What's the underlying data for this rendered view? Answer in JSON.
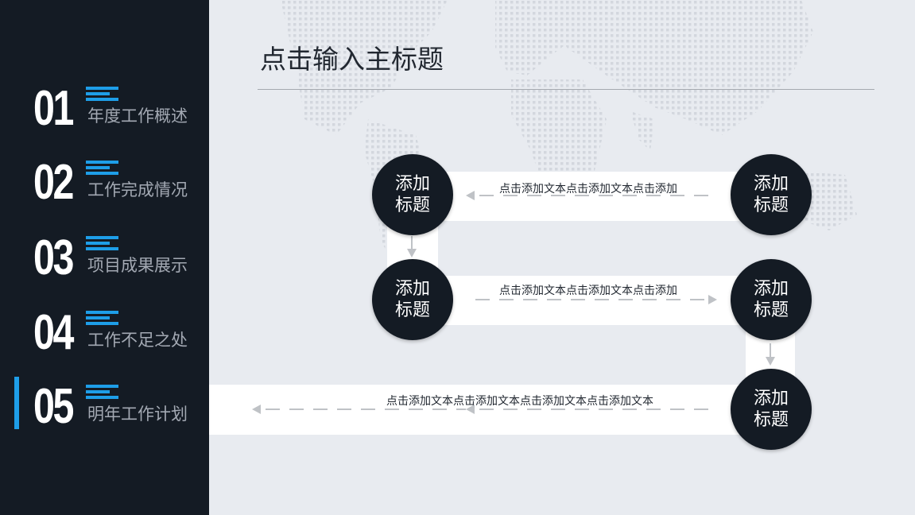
{
  "title": "点击输入主标题",
  "nav": [
    {
      "num": "01",
      "label": "年度工作概述"
    },
    {
      "num": "02",
      "label": "工作完成情况"
    },
    {
      "num": "03",
      "label": "项目成果展示"
    },
    {
      "num": "04",
      "label": "工作不足之处"
    },
    {
      "num": "05",
      "label": "明年工作计划"
    }
  ],
  "active_nav_index": 4,
  "colors": {
    "sidebar": "#141b24",
    "accent": "#1e9ee8",
    "background": "#e8ebf0",
    "circle": "#141b24"
  },
  "flow": {
    "nodes": [
      {
        "label": "添加\n标题"
      },
      {
        "label": "添加\n标题"
      },
      {
        "label": "添加\n标题"
      },
      {
        "label": "添加\n标题"
      },
      {
        "label": "添加\n标题"
      }
    ],
    "bands": [
      {
        "text": "点击添加文本点击添加文本点击添加"
      },
      {
        "text": "点击添加文本点击添加文本点击添加"
      },
      {
        "text": "点击添加文本点击添加文本点击添加文本点击添加文本"
      }
    ]
  }
}
